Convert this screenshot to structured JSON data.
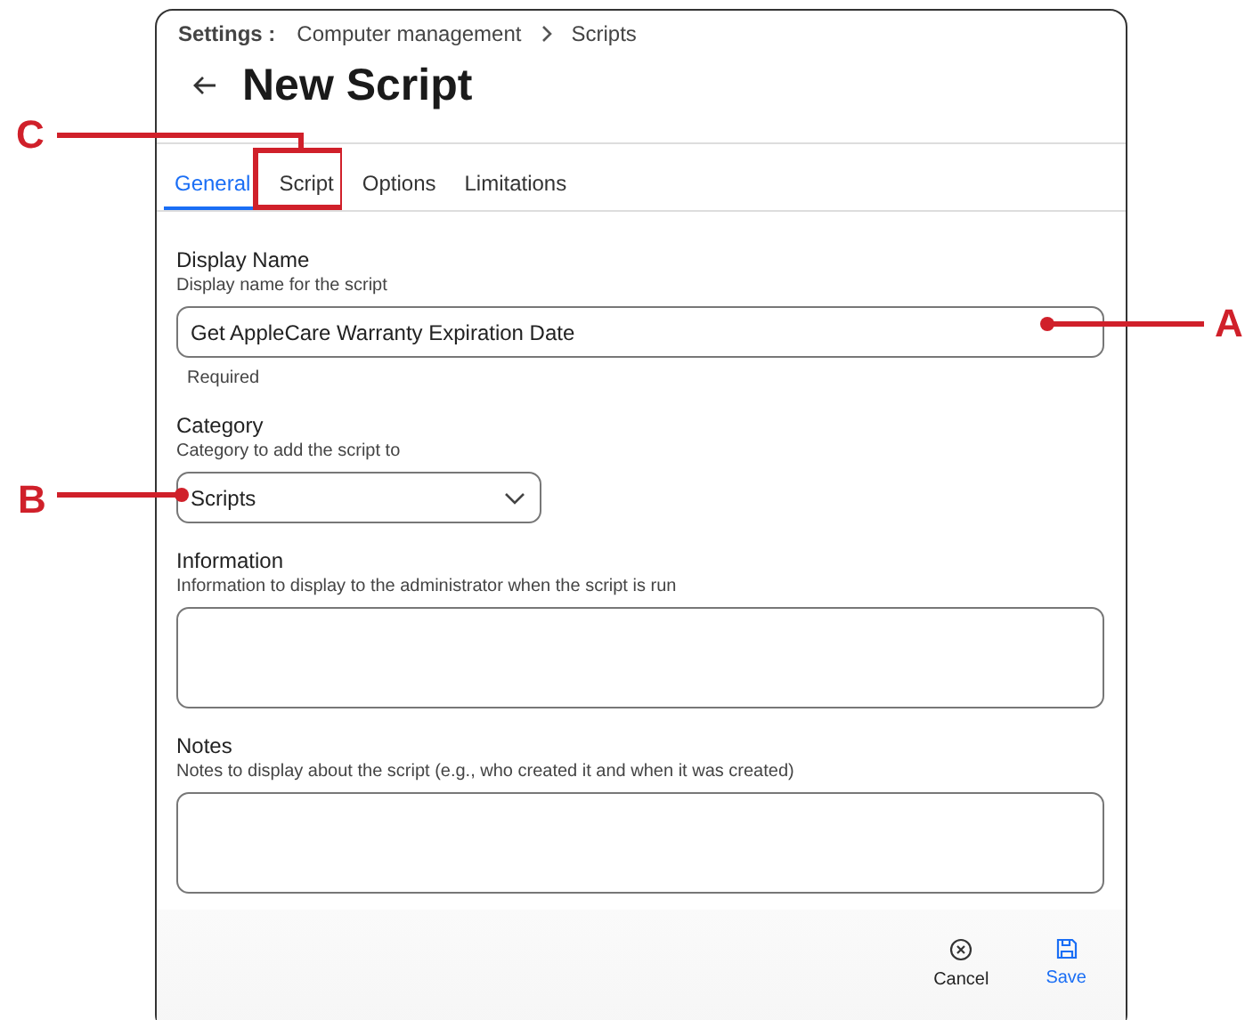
{
  "breadcrumb": {
    "root": "Settings :",
    "items": [
      "Computer management",
      "Scripts"
    ]
  },
  "title": "New Script",
  "tabs": [
    {
      "label": "General",
      "selected": true
    },
    {
      "label": "Script",
      "selected": false
    },
    {
      "label": "Options",
      "selected": false
    },
    {
      "label": "Limitations",
      "selected": false
    }
  ],
  "fields": [
    {
      "kind": "text",
      "label": "Display Name",
      "hint": "Display name for the script",
      "value": "Get AppleCare Warranty Expiration Date",
      "note": "Required"
    },
    {
      "kind": "select",
      "label": "Category",
      "hint": "Category to add the script to",
      "value": "Scripts"
    },
    {
      "kind": "textarea",
      "label": "Information",
      "hint": "Information to display to the administrator when the script is run"
    },
    {
      "kind": "textarea",
      "label": "Notes",
      "hint": "Notes to display about the script (e.g., who created it and when it was created)"
    }
  ],
  "actions": [
    {
      "kind": "cancel",
      "label": "Cancel"
    },
    {
      "kind": "save",
      "label": "Save"
    }
  ],
  "callouts": [
    {
      "label": "A"
    },
    {
      "label": "B"
    },
    {
      "label": "C"
    }
  ]
}
